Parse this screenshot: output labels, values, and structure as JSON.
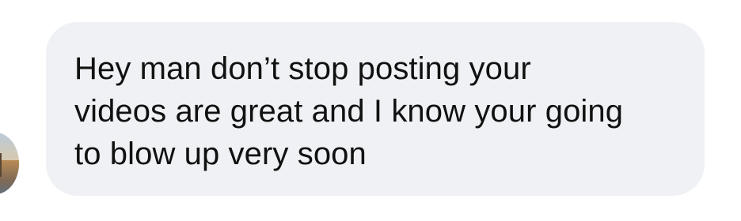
{
  "conversation": {
    "message": {
      "text": "Hey man don’t stop posting your\nvideos are great and I know your going\nto blow up very soon"
    },
    "sender": {
      "avatar_icon": "profile-photo-avatar"
    }
  },
  "colors": {
    "bubble_background": "#eff1f4",
    "text": "#111111",
    "page_background": "#ffffff"
  }
}
